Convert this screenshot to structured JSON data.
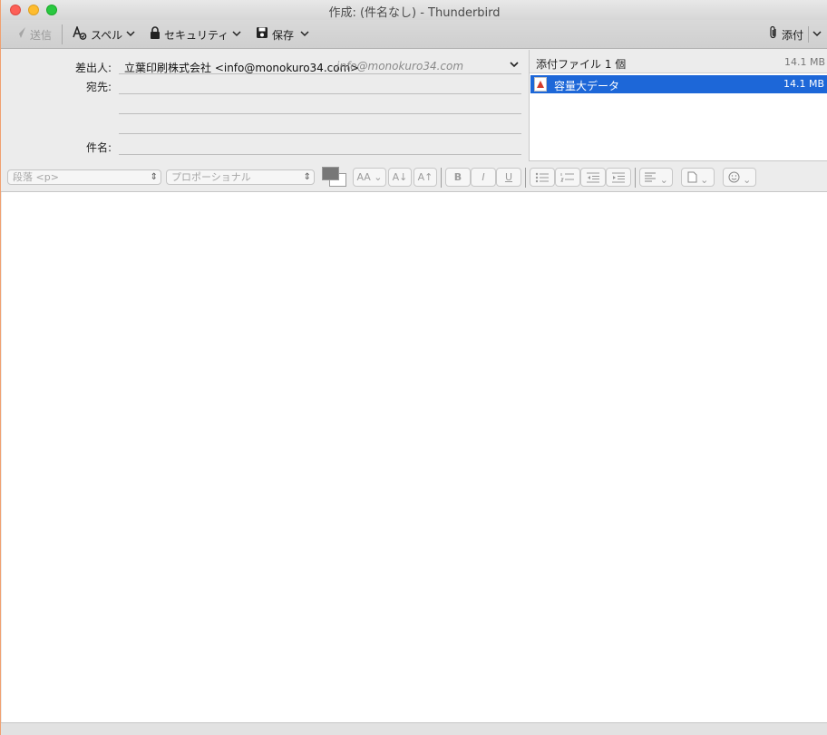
{
  "window": {
    "title": "作成: (件名なし) - Thunderbird"
  },
  "toolbar": {
    "send_label": "送信",
    "spell_label": "スペル",
    "security_label": "セキュリティ",
    "save_label": "保存",
    "attach_label": "添付"
  },
  "header": {
    "from_label": "差出人:",
    "from_value": "立葉印刷株式会社 <info@monokuro34.com>",
    "from_identity": "info@monokuro34.com",
    "to_label": "宛先:",
    "subject_label": "件名:",
    "to_value": "",
    "subject_value": ""
  },
  "attachments": {
    "title": "添付ファイル 1 個",
    "total_size": "14.1 MB",
    "items": [
      {
        "name": "容量大データ",
        "size": "14.1 MB"
      }
    ]
  },
  "format": {
    "paragraph_value": "段落 <p>",
    "font_value": "プロポーショナル",
    "bold": "B",
    "italic": "I",
    "underline": "U",
    "size_label": "AA",
    "smaller_label": "A",
    "larger_label": "A"
  },
  "colors": {
    "accent": "#1d67d8",
    "text_color": "#777777",
    "background_color": "#ffffff"
  }
}
